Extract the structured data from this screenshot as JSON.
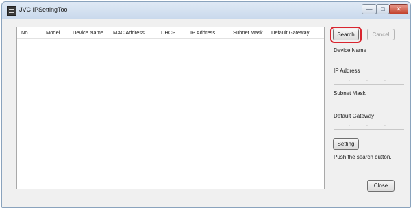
{
  "window": {
    "title": "JVC IPSettingTool",
    "controls": {
      "minimize_icon": "minimize-icon",
      "maximize_icon": "maximize-icon",
      "close_icon": "close-icon"
    }
  },
  "device_list": {
    "columns": [
      "No.",
      "Model",
      "Device Name",
      "MAC Address",
      "DHCP",
      "IP Address",
      "Subnet Mask",
      "Default Gateway"
    ],
    "rows": []
  },
  "side_panel": {
    "search_label": "Search",
    "cancel_label": "Cancel",
    "device_name_label": "Device Name",
    "device_name_value": "",
    "ip_address_label": "IP Address",
    "subnet_mask_label": "Subnet Mask",
    "default_gateway_label": "Default Gateway",
    "setting_label": "Setting",
    "status_text": "Push the search button.",
    "close_label": "Close"
  },
  "colors": {
    "highlight": "#d9252f"
  }
}
